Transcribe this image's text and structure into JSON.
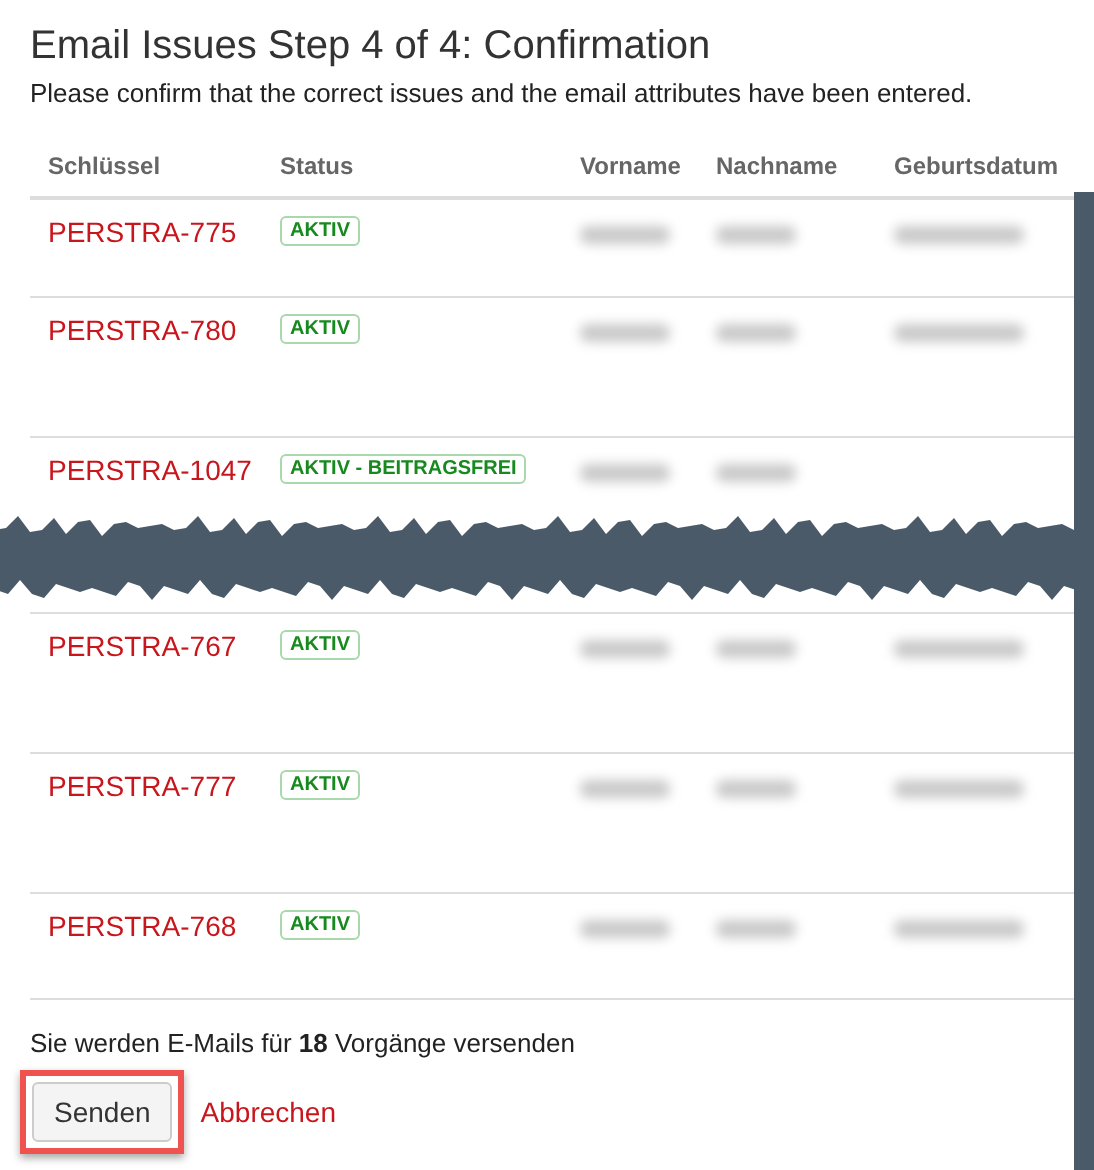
{
  "title": "Email Issues Step 4 of 4: Confirmation",
  "subtitle": "Please confirm that the correct issues and the email attributes have been entered.",
  "table": {
    "columns": [
      "Schlüssel",
      "Status",
      "Vorname",
      "Nachname",
      "Geburtsdatum"
    ],
    "rows": [
      {
        "key": "PERSTRA-775",
        "status": "AKTIV"
      },
      {
        "key": "PERSTRA-780",
        "status": "AKTIV"
      },
      {
        "key": "PERSTRA-1047",
        "status": "AKTIV - BEITRAGSFREI"
      },
      {
        "kind": "tear"
      },
      {
        "key": "PERSTRA-767",
        "status": "AKTIV"
      },
      {
        "key": "PERSTRA-777",
        "status": "AKTIV"
      },
      {
        "key": "PERSTRA-768",
        "status": "AKTIV"
      }
    ]
  },
  "summary": "Sie werden E-Mails für **18** Vorgänge versenden",
  "actions": {
    "submit": {
      "label": "Senden",
      "highlighted": true
    },
    "cancel": "Abbrechen"
  }
}
